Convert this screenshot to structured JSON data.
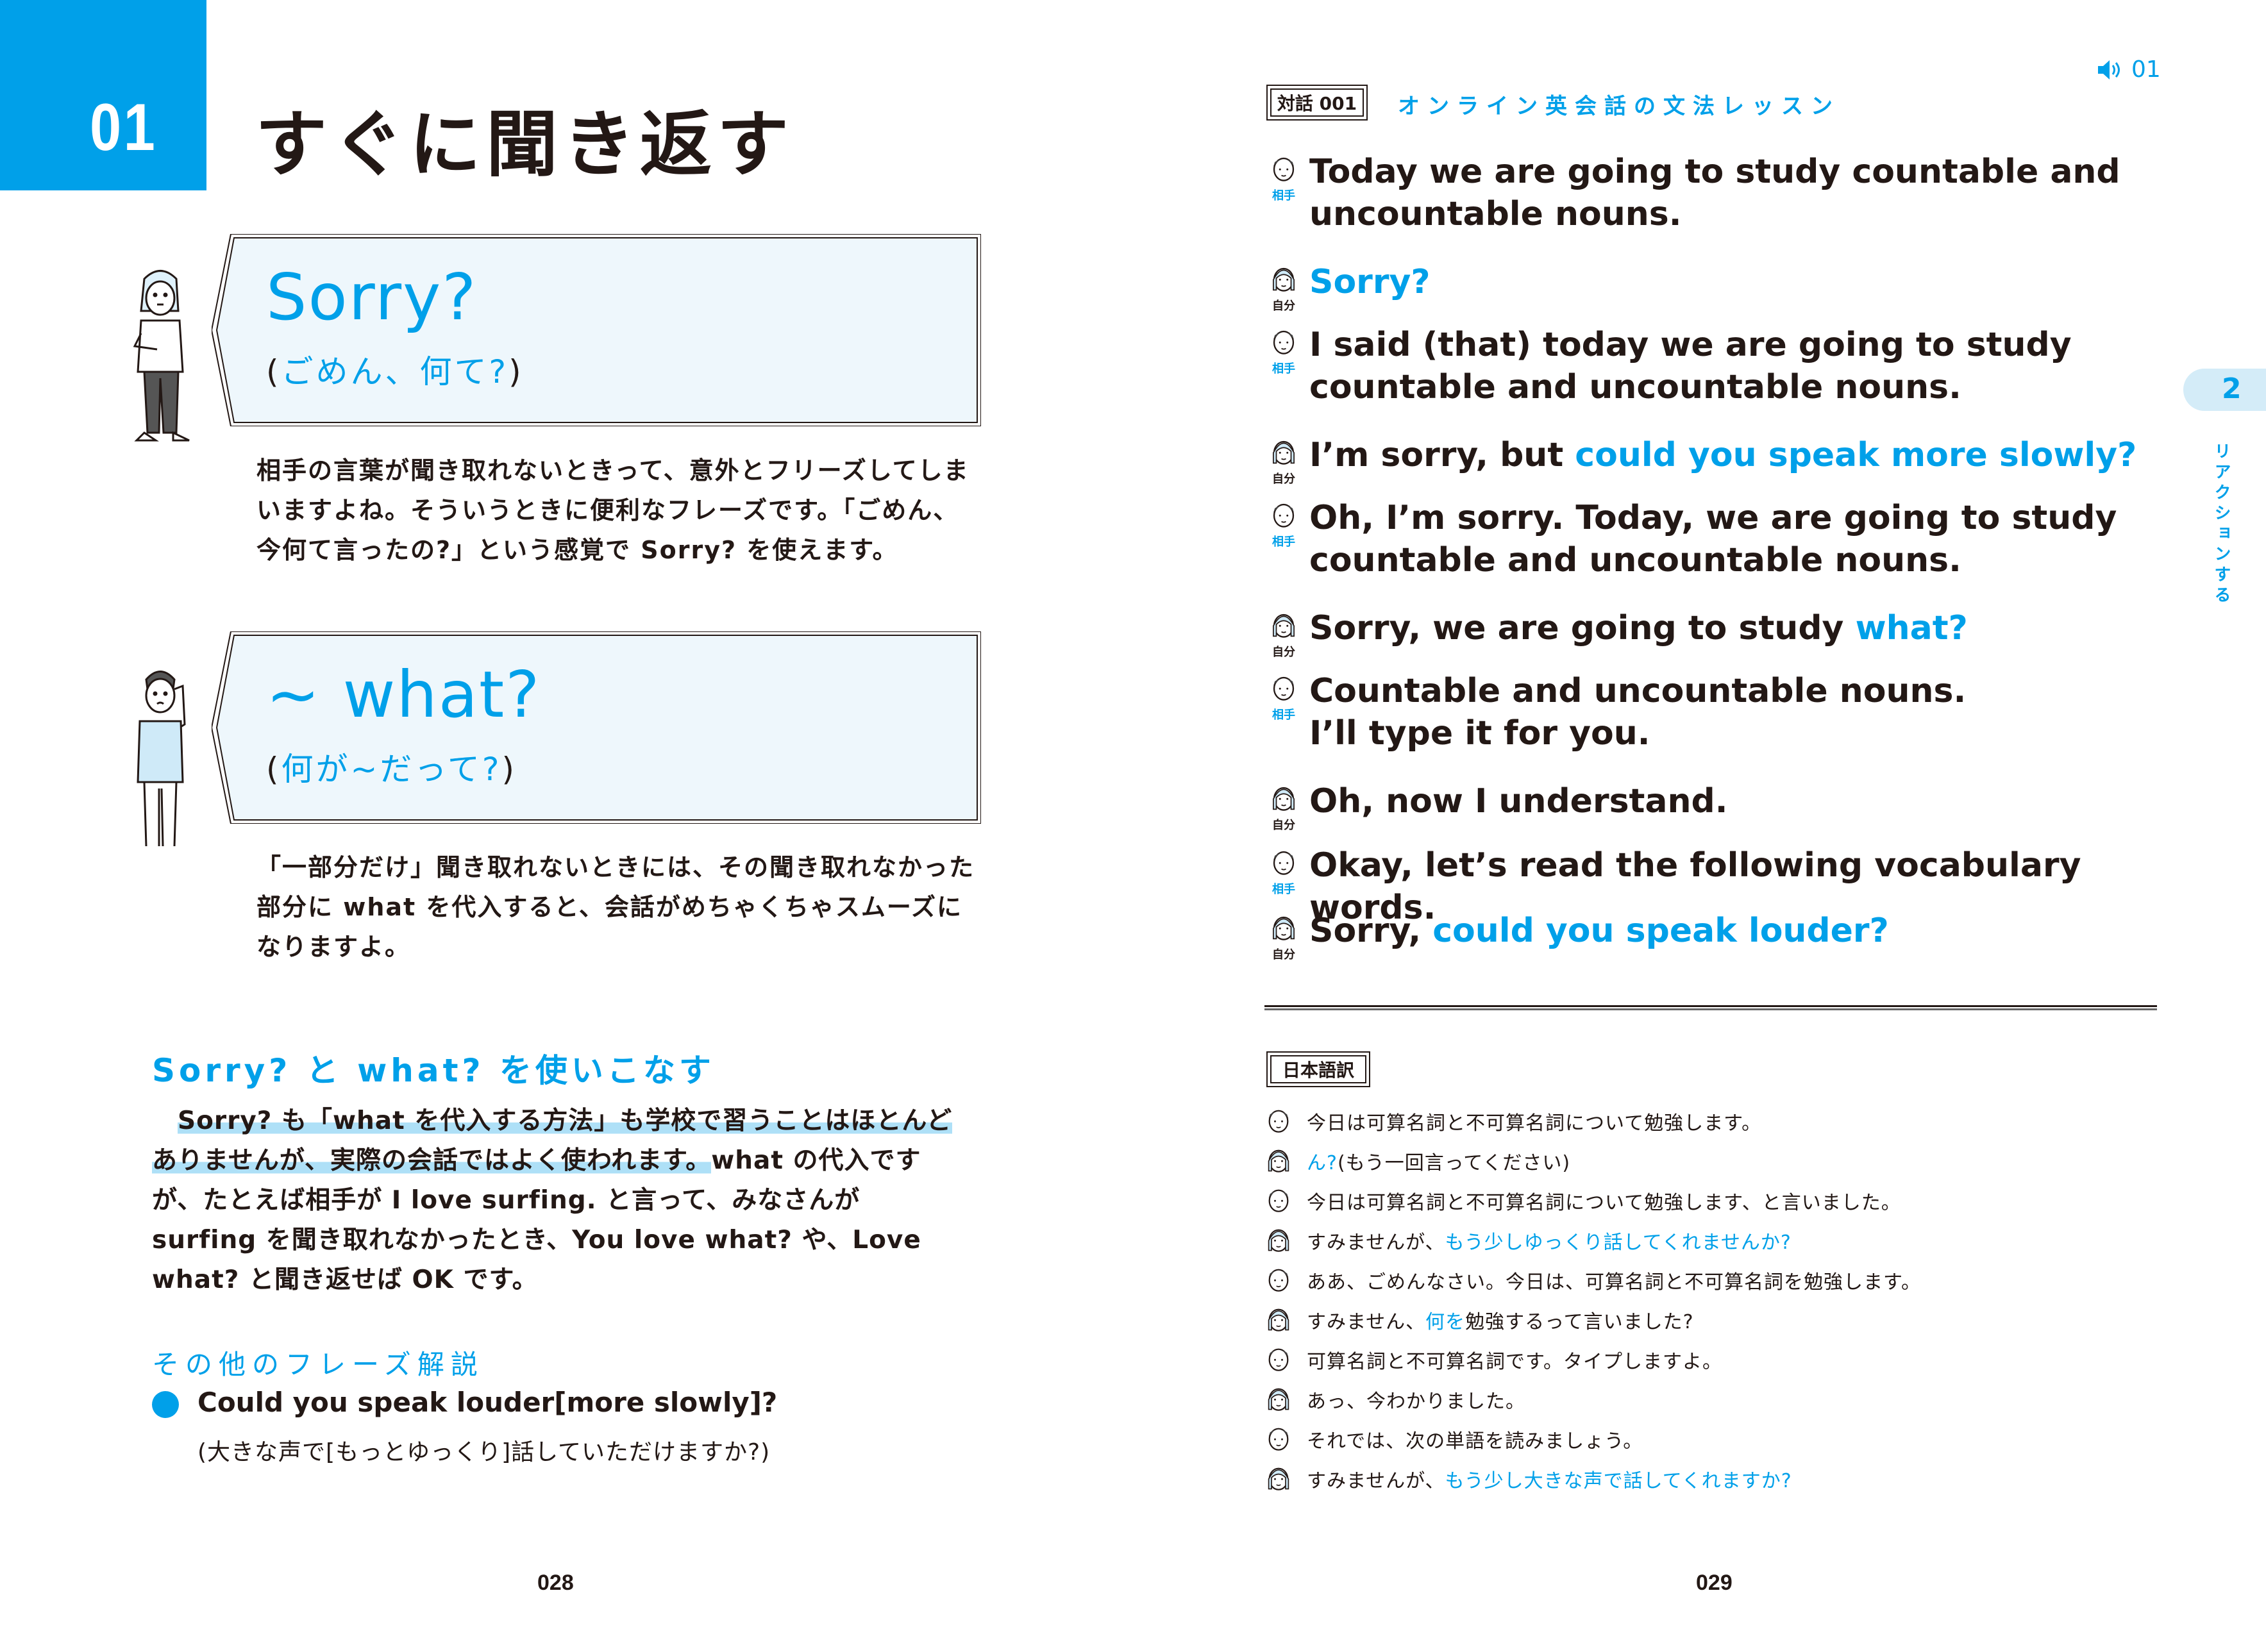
{
  "left_page": {
    "lesson_number": "01",
    "lesson_title": "すぐに聞き返す",
    "phrase_cards": [
      {
        "phrase": "Sorry?",
        "gloss_open": "(",
        "gloss": "ごめん、何て?",
        "gloss_close": ")",
        "figure": "woman-thinking-icon",
        "explanation": "相手の言葉が聞き取れないときって、意外とフリーズしてしまいますよね。そういうときに便利なフレーズです。「ごめん、今何て言ったの?」という感覚で Sorry? を使えます。"
      },
      {
        "phrase": "~ what?",
        "gloss_open": "(",
        "gloss": "何が~だって?",
        "gloss_close": ")",
        "figure": "man-cupping-ear-icon",
        "explanation": "「一部分だけ」聞き取れないときには、その聞き取れなかった部分に what を代入すると、会話がめちゃくちゃスムーズになりますよ。"
      }
    ],
    "section": {
      "heading": "Sorry? と what? を使いこなす",
      "body_highlighted": "Sorry? も「what を代入する方法」も学校で習うことはほとんどありませんが、実際の会話ではよく使われます。",
      "body_rest": "what の代入ですが、たとえば相手が I love surfing. と言って、みなさんが surfing を聞き取れなかったとき、You love what? や、Love what? と聞き返せば OK です。"
    },
    "other_phrases": {
      "heading": "その他のフレーズ解説",
      "items": [
        {
          "phrase": "Could you speak louder[more slowly]?",
          "translation": "(大きな声で[もっとゆっくり]話していただけますか?)"
        }
      ]
    },
    "page_number": "028"
  },
  "right_page": {
    "audio": {
      "icon": "speaker-icon",
      "track": "01"
    },
    "dialog_tag": "対話 001",
    "dialog_title": "オンライン英会話の文法レッスン",
    "roles": {
      "other": "相手",
      "self": "自分"
    },
    "dialog": [
      {
        "speaker": "other",
        "plain": "Today we are going to study countable and uncountable nouns.",
        "highlight": ""
      },
      {
        "speaker": "self",
        "plain": "",
        "highlight": "Sorry?"
      },
      {
        "speaker": "other",
        "plain": "I said (that) today we are going to study countable and uncountable nouns.",
        "highlight": ""
      },
      {
        "speaker": "self",
        "plain": "I’m sorry, but ",
        "highlight": "could you speak more slowly?"
      },
      {
        "speaker": "other",
        "plain": "Oh, I’m sorry. Today, we are going to study countable and uncountable nouns.",
        "highlight": ""
      },
      {
        "speaker": "self",
        "plain": "Sorry, we are going to study ",
        "highlight": "what?"
      },
      {
        "speaker": "other",
        "plain": "Countable and uncountable nouns.\nI’ll type it for you.",
        "highlight": ""
      },
      {
        "speaker": "self",
        "plain": "Oh, now I understand.",
        "highlight": ""
      },
      {
        "speaker": "other",
        "plain": "Okay, let’s read the following vocabulary words.",
        "highlight": ""
      },
      {
        "speaker": "self",
        "plain": "Sorry, ",
        "highlight": "could you speak louder?"
      }
    ],
    "translation_tag": "日本語訳",
    "translations": [
      {
        "speaker": "other",
        "parts": [
          [
            "今日は可算名詞と不可算名詞について勉強します。",
            false
          ]
        ]
      },
      {
        "speaker": "self",
        "parts": [
          [
            "ん?",
            true
          ],
          [
            "(もう一回言ってください)",
            false
          ]
        ]
      },
      {
        "speaker": "other",
        "parts": [
          [
            "今日は可算名詞と不可算名詞について勉強します、と言いました。",
            false
          ]
        ]
      },
      {
        "speaker": "self",
        "parts": [
          [
            "すみませんが、",
            false
          ],
          [
            "もう少しゆっくり話してくれませんか?",
            true
          ]
        ]
      },
      {
        "speaker": "other",
        "parts": [
          [
            "ああ、ごめんなさい。今日は、可算名詞と不可算名詞を勉強します。",
            false
          ]
        ]
      },
      {
        "speaker": "self",
        "parts": [
          [
            "すみません、",
            false
          ],
          [
            "何を",
            true
          ],
          [
            "勉強するって言いました?",
            false
          ]
        ]
      },
      {
        "speaker": "other",
        "parts": [
          [
            "可算名詞と不可算名詞です。タイプしますよ。",
            false
          ]
        ]
      },
      {
        "speaker": "self",
        "parts": [
          [
            "あっ、今わかりました。",
            false
          ]
        ]
      },
      {
        "speaker": "other",
        "parts": [
          [
            "それでは、次の単語を読みましょう。",
            false
          ]
        ]
      },
      {
        "speaker": "self",
        "parts": [
          [
            "すみませんが、",
            false
          ],
          [
            "もう少し大きな声で話してくれますか?",
            true
          ]
        ]
      }
    ],
    "chapter_tab": {
      "number": "2",
      "label": "リアクションする"
    },
    "page_number": "029"
  },
  "colors": {
    "accent": "#00a0e9",
    "text": "#231815",
    "bubble_fill": "#eef7fc",
    "highlight": "#aee0f7",
    "tab_fill": "#d4ecf8"
  }
}
